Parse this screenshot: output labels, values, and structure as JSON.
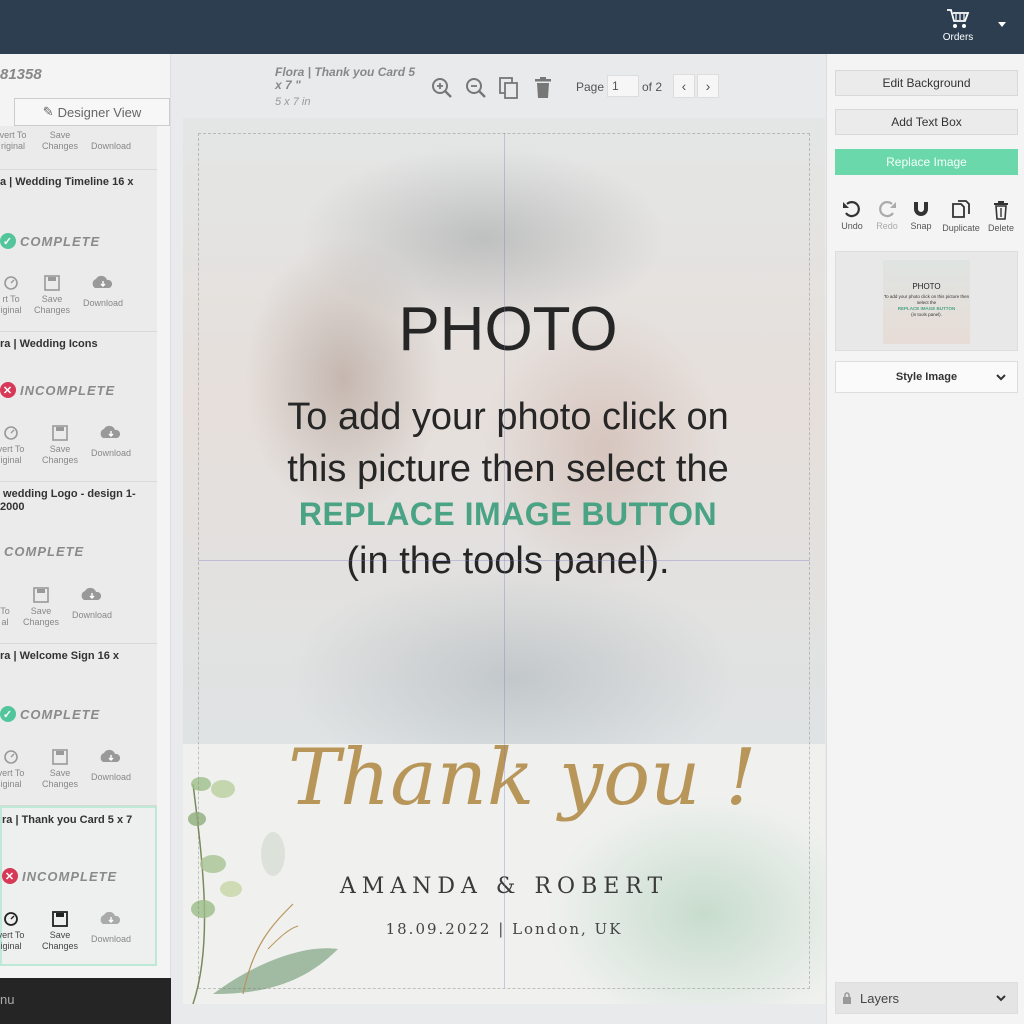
{
  "topbar": {
    "orders_label": "Orders"
  },
  "left": {
    "project_id": "81358",
    "designer_view": "Designer View",
    "cards": [
      {
        "title": "",
        "status": "",
        "actions": [
          "vert To\nriginal",
          "Save\nChanges",
          "Download"
        ]
      },
      {
        "title": "a | Wedding Timeline 16 x",
        "status": "COMPLETE",
        "actions": [
          "rt To\niginal",
          "Save\nChanges",
          "Download"
        ]
      },
      {
        "title": "ra | Wedding Icons",
        "status": "INCOMPLETE",
        "actions": [
          "vert To\niginal",
          "Save\nChanges",
          "Download"
        ]
      },
      {
        "title": " wedding Logo - design 1-\n2000",
        "status": "COMPLETE",
        "actions": [
          "To\nal",
          "Save\nChanges",
          "Download"
        ]
      },
      {
        "title": "ra | Welcome Sign 16 x",
        "status": "COMPLETE",
        "actions": [
          "vert To\niginal",
          "Save\nChanges",
          "Download"
        ]
      },
      {
        "title": "ra | Thank you Card 5 x 7",
        "status": "INCOMPLETE",
        "actions": [
          "vert To\niginal",
          "Save\nChanges",
          "Download"
        ]
      }
    ],
    "menu": "nu"
  },
  "toolbar": {
    "doc_title": "Flora | Thank you Card 5 x 7 \"",
    "doc_size": "5 x 7 in",
    "page_label": "Page",
    "page_value": "1",
    "page_of": "of 2"
  },
  "canvas": {
    "photo_title": "PHOTO",
    "line1": "To add your photo click on",
    "line2": "this picture then select the",
    "accent": "REPLACE IMAGE BUTTON",
    "line3": "(in the tools panel).",
    "script_text": "Thank you !",
    "names": "AMANDA & ROBERT",
    "date": "18.09.2022 | London, UK"
  },
  "right": {
    "edit_background": "Edit Background",
    "add_text_box": "Add Text Box",
    "replace_image": "Replace Image",
    "tools": [
      "Undo",
      "Redo",
      "Snap",
      "Duplicate",
      "Delete"
    ],
    "thumb": {
      "title": "PHOTO",
      "text": "To add your photo click on this picture then select the",
      "accent": "REPLACE IMAGE BUTTON",
      "tail": "(in tools panel)."
    },
    "style_image": "Style Image",
    "layers": "Layers"
  },
  "colors": {
    "topbar": "#2c3e50",
    "accent_green": "#6bd8ab",
    "complete": "#52c69a",
    "incomplete": "#d63a57",
    "gold": "#b8965a"
  },
  "icons": [
    "cart-icon",
    "zoom-in-icon",
    "zoom-out-icon",
    "copy-icon",
    "trash-icon",
    "undo-icon",
    "redo-icon",
    "magnet-icon",
    "duplicate-icon",
    "delete-icon",
    "lock-icon",
    "chevron-down-icon"
  ]
}
